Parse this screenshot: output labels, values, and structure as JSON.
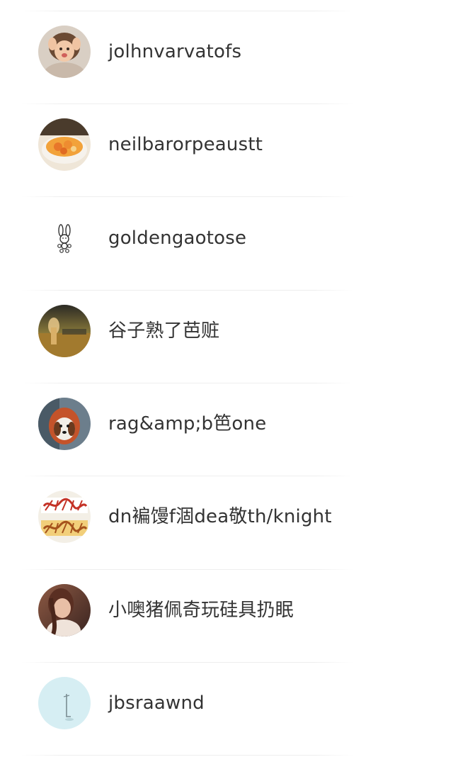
{
  "users": [
    {
      "name": "jolhnvarvatofs",
      "avatar_icon": "child-photo-avatar"
    },
    {
      "name": "neilbarorpeaustt",
      "avatar_icon": "food-bowl-avatar"
    },
    {
      "name": "goldengaotose",
      "avatar_icon": "bunny-sketch-avatar"
    },
    {
      "name": "谷子熟了芭赃",
      "avatar_icon": "sunset-field-avatar"
    },
    {
      "name": "rag&amp;b笆one",
      "avatar_icon": "hooded-dog-avatar"
    },
    {
      "name": "dn褊馒f涸dea敬th/knight",
      "avatar_icon": "chinese-calligraphy-avatar"
    },
    {
      "name": "小噢猪佩奇玩硅具扔眠",
      "avatar_icon": "woman-portrait-avatar"
    },
    {
      "name": "jbsraawnd",
      "avatar_icon": "light-blue-sketch-avatar"
    }
  ]
}
